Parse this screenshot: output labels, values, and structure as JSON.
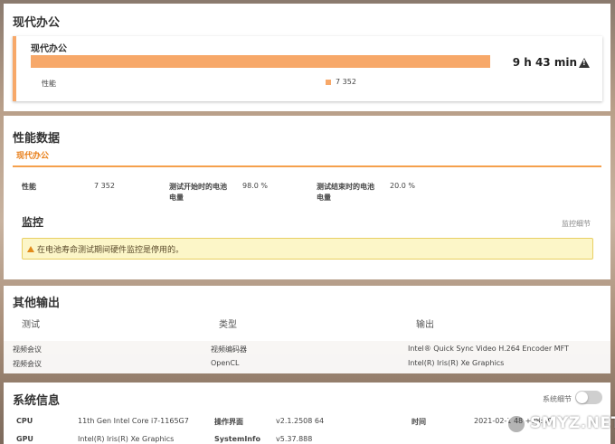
{
  "section1": {
    "title": "现代办公",
    "card": {
      "title": "现代办公",
      "result": "9 h 43 min",
      "row_label": "性能",
      "row_value": "7 352",
      "accent": "#f7a869",
      "bar_fraction": 0.94
    }
  },
  "section2": {
    "title": "性能数据",
    "tab": "现代办公",
    "metrics": [
      {
        "label": "性能",
        "value": "7 352"
      },
      {
        "label": "测试开始时的电池电量",
        "value": "98.0 %"
      },
      {
        "label": "测试结束时的电池电量",
        "value": "20.0 %"
      }
    ],
    "monitor_title": "监控",
    "monitor_link": "监控细节",
    "warning": "在电池寿命测试期间硬件监控是停用的。"
  },
  "section3": {
    "title": "其他输出",
    "headers": [
      "测试",
      "类型",
      "输出"
    ],
    "rows": [
      [
        "视频会议",
        "视频编码器",
        "Intel® Quick Sync Video H.264 Encoder MFT"
      ],
      [
        "视频会议",
        "OpenCL",
        "Intel(R) Iris(R) Xe Graphics"
      ]
    ]
  },
  "section4": {
    "title": "系统信息",
    "toggle_label": "系统细节",
    "rows": [
      [
        {
          "label": "CPU",
          "value": "11th Gen Intel Core i7-1165G7"
        },
        {
          "label": "操作界面",
          "value": "v2.1.2508 64"
        },
        {
          "label": "时间",
          "value": "2021-02-1   48 +08:00"
        }
      ],
      [
        {
          "label": "GPU",
          "value": "Intel(R) Iris(R) Xe Graphics"
        },
        {
          "label": "SystemInfo",
          "value": "v5.37.888"
        },
        {
          "label": "",
          "value": ""
        }
      ]
    ]
  },
  "watermark": "SMYZ.NET"
}
